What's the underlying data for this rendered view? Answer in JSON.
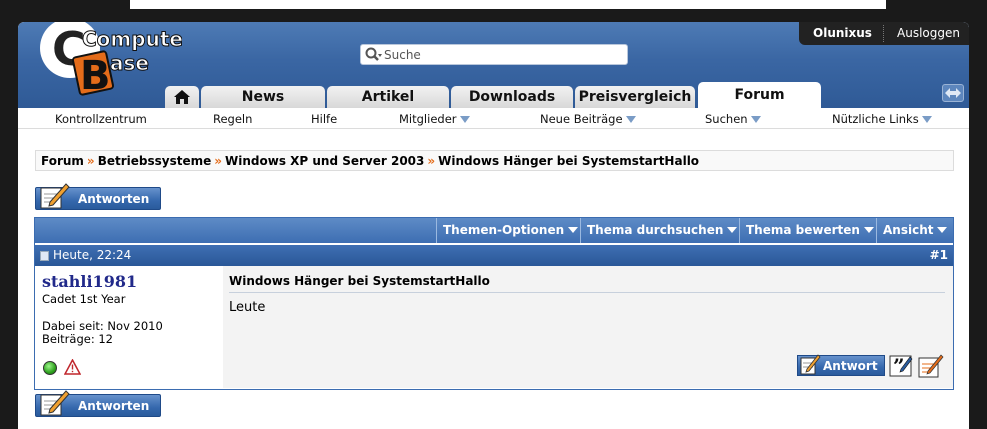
{
  "header": {
    "logo_line1": "Computer",
    "logo_line2": "Base",
    "search_placeholder": "Suche",
    "username": "Olunixus",
    "logout": "Ausloggen"
  },
  "tabs": [
    {
      "label": "News"
    },
    {
      "label": "Artikel"
    },
    {
      "label": "Downloads"
    },
    {
      "label": "Preisvergleich"
    },
    {
      "label": "Forum"
    }
  ],
  "subnav": {
    "items": [
      "Kontrollzentrum",
      "Regeln",
      "Hilfe",
      "Mitglieder",
      "Neue Beiträge",
      "Suchen",
      "Nützliche Links"
    ]
  },
  "breadcrumb": [
    "Forum",
    "Betriebssysteme",
    "Windows XP und Server 2003",
    "Windows Hänger bei SystemstartHallo"
  ],
  "reply_button": "Antworten",
  "toolbar": [
    "Themen-Optionen",
    "Thema durchsuchen",
    "Thema bewerten",
    "Ansicht"
  ],
  "post": {
    "date": "Heute, 22:24",
    "number": "#1",
    "author": "stahli1981",
    "rank": "Cadet 1st Year",
    "joined": "Dabei seit: Nov 2010",
    "posts": "Beiträge: 12",
    "title": "Windows Hänger bei SystemstartHallo",
    "text": "Leute",
    "reply_label": "Antwort"
  },
  "colors": {
    "header_blue": "#3a66a3",
    "toolbar_blue": "#4a7bbd",
    "accent_orange": "#e46c1a",
    "username_color": "#21298a"
  }
}
